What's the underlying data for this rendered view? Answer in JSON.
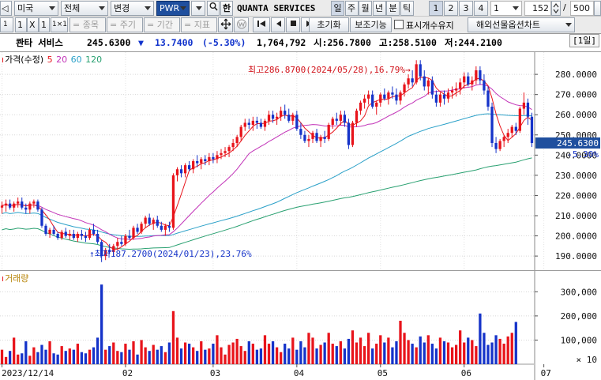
{
  "toolbar1": {
    "prev_glyph": "◁",
    "market": "미국",
    "filter": "전체",
    "change": "변경",
    "symbol_code": "PWR",
    "hangul_toggle": "한",
    "company_name": "QUANTA SERVICES",
    "periods": [
      "일",
      "주",
      "월",
      "년",
      "분",
      "틱"
    ],
    "active_period": "일",
    "numbers": [
      "1",
      "2",
      "3",
      "4"
    ],
    "active_number": "1",
    "interval_value": "1",
    "count_value": "152",
    "slash": "/",
    "max_count": "500"
  },
  "toolbar2": {
    "layout_1": "1",
    "layout_x": "X",
    "layout_1b": "1",
    "layout_1x1": "1×1",
    "item_btn": "= 종목",
    "period_btn": "= 주기",
    "range_btn": "= 기간",
    "indicator_btn": "= 지표",
    "reset_btn": "초기화",
    "aux_btn": "보조기능",
    "show_count_label": "표시개수유지",
    "futures_btn": "해외선물옵션차트"
  },
  "quote": {
    "name": "콴타 서비스",
    "price": "245.6300",
    "change_arrow": "▼",
    "change": "13.7400",
    "change_pct": "(-5.30%)",
    "volume": "1,764,792",
    "open": "시:256.7800",
    "high": "고:258.5100",
    "low": "저:244.2100",
    "period_badge": "[1일]"
  },
  "price_pane": {
    "legend_title": "가격(수정)",
    "ma_labels": [
      "5",
      "20",
      "60",
      "120"
    ],
    "y_ticks": [
      "280.0000",
      "270.0000",
      "260.0000",
      "250.0000",
      "240.0000",
      "230.0000",
      "220.0000",
      "210.0000",
      "200.0000",
      "190.0000"
    ],
    "current_price_tag": "245.6300",
    "current_change_tag": "-5.30%",
    "high_annotation": "최고286.8700(2024/05/28),16.79%",
    "low_annotation": "최저187.2700(2024/01/23),23.76%"
  },
  "volume_pane": {
    "legend_title": "거래량",
    "y_ticks": [
      "300,000",
      "200,000",
      "100,000"
    ],
    "scale_note": "× 10"
  },
  "x_axis": {
    "labels": [
      "2023/12/14",
      "02",
      "03",
      "04",
      "05",
      "06",
      "07"
    ]
  },
  "colors": {
    "up": "#e8141b",
    "down": "#1533c9",
    "ma5": "#e8141b",
    "ma20": "#c233b8",
    "ma60": "#2aa0c8",
    "ma120": "#28a070",
    "highlight": "#1f4f9e"
  },
  "chart_data": {
    "type": "candlestick",
    "title": "콴타 서비스",
    "y_range": [
      183,
      291
    ],
    "volume_range": [
      0,
      360000
    ],
    "x_labels": [
      "2023/12/14",
      "02",
      "03",
      "04",
      "05",
      "06",
      "07"
    ],
    "ohlc": [
      [
        214,
        217,
        211,
        215
      ],
      [
        215,
        218,
        212,
        216
      ],
      [
        216,
        218,
        213,
        214
      ],
      [
        214,
        217,
        212,
        216
      ],
      [
        216,
        219,
        214,
        217
      ],
      [
        217,
        219,
        213,
        214
      ],
      [
        214,
        216,
        211,
        213
      ],
      [
        213,
        217,
        211,
        216
      ],
      [
        216,
        218,
        214,
        217
      ],
      [
        217,
        218,
        212,
        213
      ],
      [
        213,
        214,
        204,
        205
      ],
      [
        205,
        206,
        200,
        201
      ],
      [
        201,
        204,
        199,
        203
      ],
      [
        203,
        205,
        200,
        201
      ],
      [
        201,
        202,
        198,
        199
      ],
      [
        199,
        203,
        198,
        202
      ],
      [
        202,
        204,
        199,
        200
      ],
      [
        200,
        203,
        198,
        201
      ],
      [
        201,
        203,
        198,
        199
      ],
      [
        199,
        202,
        197,
        201
      ],
      [
        201,
        203,
        198,
        200
      ],
      [
        200,
        202,
        197,
        199
      ],
      [
        199,
        204,
        198,
        203
      ],
      [
        203,
        206,
        200,
        201
      ],
      [
        201,
        203,
        196,
        197
      ],
      [
        197,
        198,
        187,
        190
      ],
      [
        190,
        194,
        188,
        193
      ],
      [
        193,
        196,
        191,
        192
      ],
      [
        192,
        196,
        190,
        195
      ],
      [
        195,
        199,
        193,
        197
      ],
      [
        197,
        200,
        195,
        196
      ],
      [
        196,
        201,
        195,
        200
      ],
      [
        200,
        203,
        198,
        199
      ],
      [
        199,
        205,
        198,
        204
      ],
      [
        204,
        206,
        201,
        202
      ],
      [
        202,
        207,
        201,
        206
      ],
      [
        206,
        210,
        204,
        209
      ],
      [
        209,
        211,
        205,
        206
      ],
      [
        206,
        209,
        203,
        208
      ],
      [
        208,
        210,
        204,
        205
      ],
      [
        205,
        207,
        202,
        203
      ],
      [
        203,
        206,
        200,
        205
      ],
      [
        205,
        207,
        202,
        204
      ],
      [
        204,
        231,
        203,
        230
      ],
      [
        230,
        234,
        227,
        233
      ],
      [
        233,
        235,
        229,
        231
      ],
      [
        231,
        236,
        229,
        235
      ],
      [
        235,
        237,
        232,
        233
      ],
      [
        233,
        238,
        231,
        237
      ],
      [
        237,
        240,
        234,
        236
      ],
      [
        236,
        239,
        233,
        238
      ],
      [
        238,
        240,
        235,
        237
      ],
      [
        237,
        241,
        235,
        239
      ],
      [
        239,
        241,
        236,
        238
      ],
      [
        238,
        242,
        236,
        240
      ],
      [
        240,
        243,
        238,
        241
      ],
      [
        241,
        244,
        239,
        242
      ],
      [
        242,
        245,
        239,
        244
      ],
      [
        244,
        248,
        242,
        246
      ],
      [
        246,
        250,
        244,
        249
      ],
      [
        249,
        255,
        247,
        254
      ],
      [
        254,
        258,
        252,
        256
      ],
      [
        256,
        258,
        253,
        255
      ],
      [
        255,
        259,
        252,
        257
      ],
      [
        257,
        259,
        253,
        256
      ],
      [
        256,
        258,
        253,
        254
      ],
      [
        254,
        258,
        252,
        257
      ],
      [
        257,
        262,
        255,
        260
      ],
      [
        260,
        262,
        256,
        258
      ],
      [
        258,
        261,
        255,
        259
      ],
      [
        259,
        264,
        257,
        262
      ],
      [
        262,
        265,
        258,
        260
      ],
      [
        260,
        263,
        256,
        257
      ],
      [
        257,
        261,
        255,
        260
      ],
      [
        260,
        262,
        252,
        253
      ],
      [
        253,
        256,
        248,
        250
      ],
      [
        250,
        252,
        246,
        247
      ],
      [
        247,
        250,
        244,
        248
      ],
      [
        248,
        252,
        246,
        251
      ],
      [
        251,
        253,
        246,
        247
      ],
      [
        247,
        250,
        244,
        249
      ],
      [
        249,
        252,
        246,
        248
      ],
      [
        248,
        256,
        247,
        255
      ],
      [
        255,
        259,
        253,
        258
      ],
      [
        258,
        261,
        255,
        257
      ],
      [
        257,
        262,
        255,
        260
      ],
      [
        260,
        262,
        254,
        256
      ],
      [
        256,
        258,
        243,
        245
      ],
      [
        245,
        257,
        244,
        256
      ],
      [
        256,
        263,
        254,
        262
      ],
      [
        262,
        267,
        260,
        266
      ],
      [
        266,
        270,
        263,
        268
      ],
      [
        268,
        272,
        265,
        270
      ],
      [
        270,
        272,
        263,
        264
      ],
      [
        264,
        267,
        260,
        266
      ],
      [
        266,
        271,
        264,
        270
      ],
      [
        270,
        273,
        267,
        268
      ],
      [
        268,
        272,
        265,
        271
      ],
      [
        271,
        274,
        268,
        270
      ],
      [
        270,
        273,
        265,
        267
      ],
      [
        267,
        272,
        265,
        271
      ],
      [
        271,
        276,
        269,
        275
      ],
      [
        275,
        280,
        273,
        278
      ],
      [
        278,
        282,
        274,
        276
      ],
      [
        276,
        287,
        275,
        285
      ],
      [
        285,
        287,
        277,
        279
      ],
      [
        279,
        282,
        272,
        274
      ],
      [
        274,
        278,
        270,
        277
      ],
      [
        277,
        279,
        268,
        270
      ],
      [
        270,
        272,
        264,
        266
      ],
      [
        266,
        271,
        264,
        270
      ],
      [
        270,
        272,
        265,
        268
      ],
      [
        268,
        273,
        266,
        271
      ],
      [
        271,
        274,
        268,
        272
      ],
      [
        272,
        276,
        269,
        273
      ],
      [
        273,
        278,
        270,
        276
      ],
      [
        276,
        281,
        273,
        279
      ],
      [
        279,
        281,
        274,
        275
      ],
      [
        275,
        279,
        272,
        277
      ],
      [
        277,
        284,
        275,
        282
      ],
      [
        282,
        284,
        275,
        277
      ],
      [
        277,
        280,
        270,
        272
      ],
      [
        272,
        274,
        262,
        264
      ],
      [
        264,
        266,
        244,
        246
      ],
      [
        246,
        249,
        241,
        243
      ],
      [
        243,
        248,
        242,
        247
      ],
      [
        247,
        250,
        244,
        249
      ],
      [
        249,
        253,
        246,
        251
      ],
      [
        251,
        255,
        249,
        254
      ],
      [
        254,
        256,
        250,
        252
      ],
      [
        252,
        264,
        251,
        263
      ],
      [
        263,
        271,
        260,
        266
      ],
      [
        266,
        268,
        255,
        259
      ],
      [
        259,
        261,
        244,
        246
      ]
    ],
    "volume": [
      60000,
      30000,
      55000,
      110000,
      40000,
      45000,
      95000,
      35000,
      70000,
      50000,
      80000,
      60000,
      95000,
      45000,
      40000,
      75000,
      55000,
      65000,
      60000,
      85000,
      50000,
      45000,
      60000,
      70000,
      110000,
      330000,
      60000,
      75000,
      90000,
      55000,
      50000,
      85000,
      60000,
      95000,
      40000,
      100000,
      70000,
      55000,
      80000,
      60000,
      75000,
      50000,
      90000,
      220000,
      110000,
      65000,
      90000,
      85000,
      70000,
      55000,
      95000,
      60000,
      65000,
      85000,
      120000,
      70000,
      40000,
      80000,
      90000,
      105000,
      75000,
      55000,
      95000,
      85000,
      60000,
      65000,
      120000,
      85000,
      95000,
      70000,
      50000,
      85000,
      65000,
      110000,
      60000,
      95000,
      70000,
      130000,
      110000,
      65000,
      80000,
      90000,
      130000,
      85000,
      75000,
      95000,
      65000,
      105000,
      140000,
      90000,
      110000,
      75000,
      130000,
      65000,
      85000,
      120000,
      90000,
      110000,
      70000,
      95000,
      180000,
      130000,
      100000,
      85000,
      70000,
      115000,
      90000,
      120000,
      85000,
      65000,
      110000,
      95000,
      90000,
      70000,
      80000,
      140000,
      90000,
      110000,
      100000,
      75000,
      210000,
      130000,
      80000,
      90000,
      120000,
      105000,
      85000,
      115000,
      130000,
      175000
    ]
  }
}
